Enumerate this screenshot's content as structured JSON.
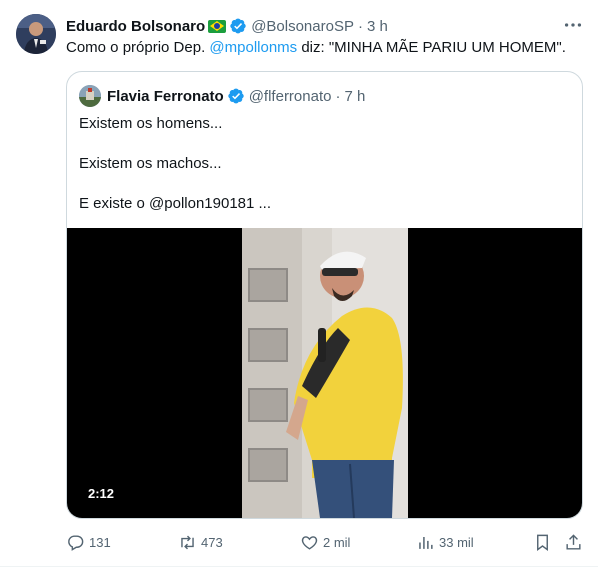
{
  "tweet": {
    "author_name": "Eduardo Bolsonaro",
    "handle": "@BolsonaroSP",
    "separator": "·",
    "time": "3 h",
    "text_prefix": "Como o próprio Dep. ",
    "mention": "@mpollonms",
    "text_suffix": " diz: \"MINHA MÃE PARIU UM HOMEM\".",
    "more_icon": "more-horizontal-icon",
    "verified_icon": "verified-badge-icon",
    "flag_icon": "brazil-flag-icon"
  },
  "quoted_tweet": {
    "author_name": "Flavia Ferronato",
    "handle": "@flferronato",
    "separator": "·",
    "time": "7 h",
    "lines": [
      "Existem os homens...",
      "Existem os machos...",
      "E existe o @pollon190181 ..."
    ],
    "video": {
      "duration": "2:12"
    }
  },
  "actions": {
    "reply": {
      "count": "131",
      "icon": "reply-icon"
    },
    "retweet": {
      "count": "473",
      "icon": "retweet-icon"
    },
    "like": {
      "count": "2 mil",
      "icon": "heart-icon"
    },
    "views": {
      "count": "33 mil",
      "icon": "views-chart-icon"
    },
    "bookmark": {
      "icon": "bookmark-icon"
    },
    "share": {
      "icon": "share-icon"
    }
  },
  "colors": {
    "accent": "#1d9bf0",
    "text": "#0f1419",
    "muted": "#536471",
    "border": "#cfd9de",
    "video_bg": "#000000"
  }
}
